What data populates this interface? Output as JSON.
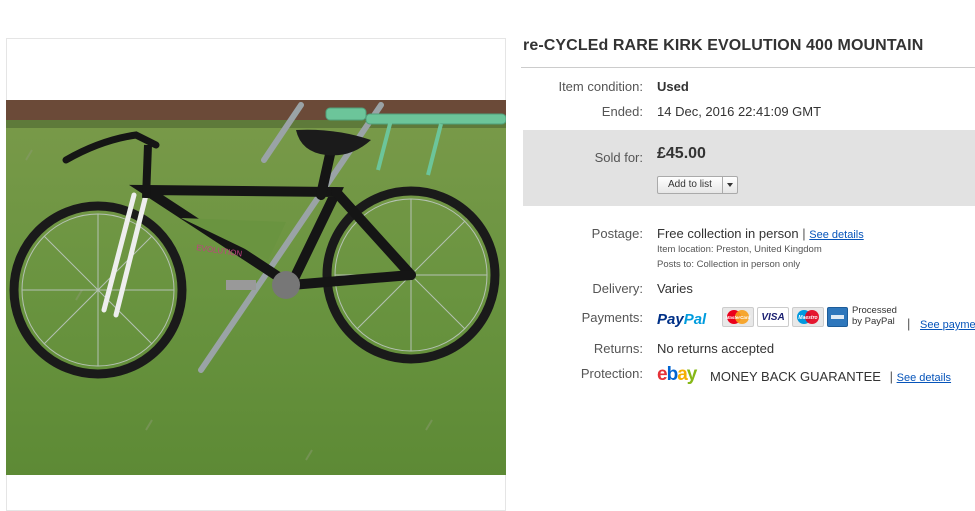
{
  "listing": {
    "title": "re-CYCLEd RARE KIRK EVOLUTION 400 MOUNTAIN"
  },
  "details": {
    "condition_label": "Item condition:",
    "condition_value": "Used",
    "ended_label": "Ended:",
    "ended_value": "14 Dec, 2016  22:41:09 GMT",
    "sold_label": "Sold for:",
    "price": "£45.00",
    "add_to_list": "Add to list",
    "postage_label": "Postage:",
    "postage_value": "Free collection in person",
    "postage_sep": "|",
    "see_details": "See details",
    "item_location": "Item location:  Preston, United Kingdom",
    "posts_to": "Posts to:  Collection in person only",
    "delivery_label": "Delivery:",
    "delivery_value": "Varies",
    "payments_label": "Payments:",
    "paypal_part1": "Pay",
    "paypal_part2": "Pal",
    "card_mastercard": "MasterCard",
    "card_visa": "VISA",
    "card_maestro": "Maestro",
    "processed_line1": "Processed",
    "processed_line2": "by PayPal",
    "payments_sep": "|",
    "see_payments": "See payme",
    "returns_label": "Returns:",
    "returns_value": "No returns accepted",
    "protection_label": "Protection:",
    "ebay_e": "e",
    "ebay_b": "b",
    "ebay_a": "a",
    "ebay_y": "y",
    "guarantee": "MONEY BACK GUARANTEE",
    "protection_sep": "|",
    "protection_see_details": "See details"
  },
  "colors": {
    "link": "#0654ba",
    "sold_box": "#e2e2e2",
    "paypal_dark": "#003087",
    "paypal_light": "#009cde"
  }
}
